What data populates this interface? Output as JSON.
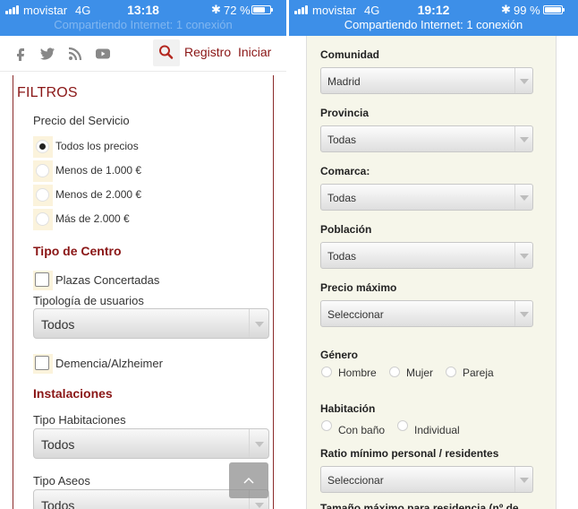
{
  "left": {
    "status": {
      "carrier": "movistar",
      "network": "4G",
      "time": "13:18",
      "battery_text": "72 %",
      "battery_level": 0.72,
      "banner": "Compartiendo Internet: 1 conexión"
    },
    "nav": {
      "register": "Registro",
      "login": "Iniciar"
    },
    "filters_title": "FILTROS",
    "price": {
      "label": "Precio del Servicio",
      "options": [
        "Todos los precios",
        "Menos de 1.000 €",
        "Menos de 2.000 €",
        "Más de 2.000 €"
      ],
      "selected_index": 0
    },
    "center_type": {
      "title": "Tipo de Centro",
      "checkbox_label": "Plazas Concertadas",
      "users_label": "Tipología de usuarios",
      "users_value": "Todos",
      "dementia_label": "Demencia/Alzheimer"
    },
    "facilities": {
      "title": "Instalaciones",
      "rooms_label": "Tipo Habitaciones",
      "rooms_value": "Todos",
      "toilets_label": "Tipo Aseos",
      "toilets_value": "Todos"
    },
    "to_top_icon": "chevron-up-icon"
  },
  "right": {
    "status": {
      "carrier": "movistar",
      "network": "4G",
      "time": "19:12",
      "battery_text": "99 %",
      "battery_level": 0.99,
      "banner": "Compartiendo Internet: 1 conexión"
    },
    "fields": {
      "comunidad": {
        "label": "Comunidad",
        "value": "Madrid"
      },
      "provincia": {
        "label": "Provincia",
        "value": "Todas"
      },
      "comarca": {
        "label": "Comarca:",
        "value": "Todas"
      },
      "poblacion": {
        "label": "Población",
        "value": "Todas"
      },
      "precio": {
        "label": "Precio máximo",
        "value": "Seleccionar"
      },
      "ratio": {
        "label": "Ratio mínimo personal / residentes",
        "value": "Seleccionar"
      }
    },
    "genero": {
      "label": "Género",
      "options": [
        "Hombre",
        "Mujer",
        "Pareja"
      ]
    },
    "habitacion": {
      "label": "Habitación",
      "options": [
        "Con baño",
        "Individual"
      ]
    },
    "cutoff_text": "Tamaño máximo para residencia (nº de"
  }
}
